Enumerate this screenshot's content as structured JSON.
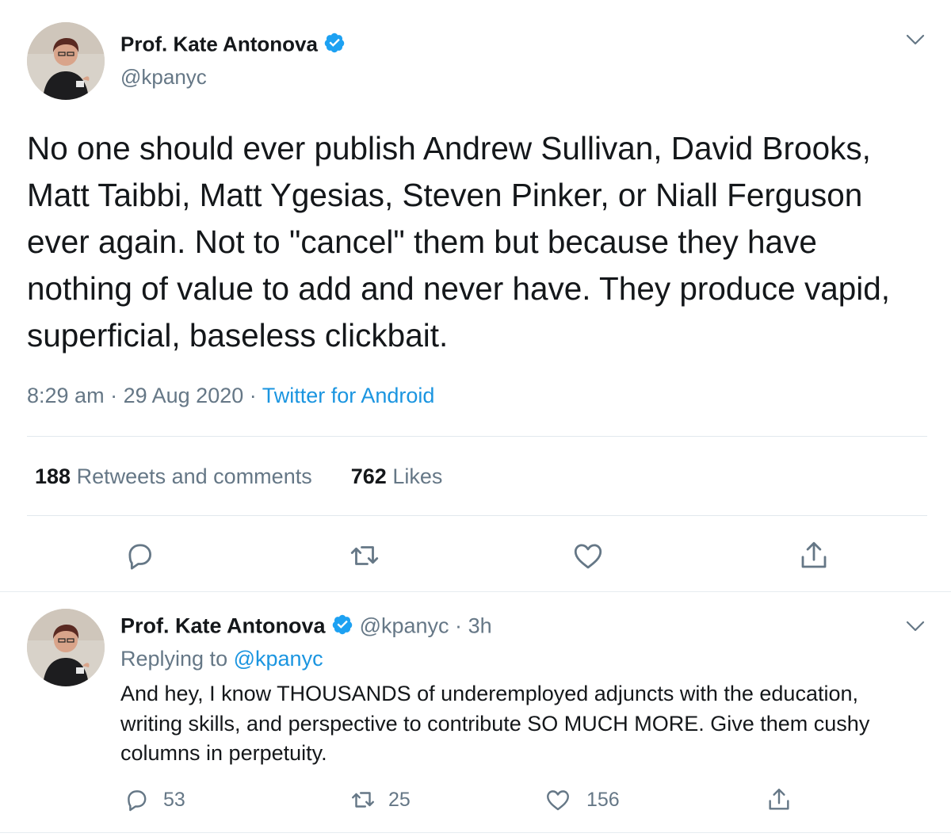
{
  "main_tweet": {
    "display_name": "Prof. Kate Antonova",
    "handle": "@kpanyc",
    "text": "No one should ever publish Andrew Sullivan, David Brooks, Matt Taibbi, Matt Ygesias, Steven Pinker, or Niall Ferguson ever again. Not to \"cancel\" them but because they have nothing of value to add and never have. They produce vapid, superficial, baseless clickbait.",
    "time": "8:29 am",
    "sep1": "·",
    "date": "29 Aug 2020",
    "sep2": "·",
    "source": "Twitter for Android",
    "retweets_count": "188",
    "retweets_label": "Retweets and comments",
    "likes_count": "762",
    "likes_label": "Likes"
  },
  "reply_tweet": {
    "display_name": "Prof. Kate Antonova",
    "handle": "@kpanyc",
    "sep": "·",
    "age": "3h",
    "replying_prefix": "Replying to",
    "replying_handle": "@kpanyc",
    "text": "And hey, I know THOUSANDS of underemployed adjuncts with the education, writing skills, and perspective to contribute SO MUCH MORE. Give them cushy columns in perpetuity.",
    "reply_count": "53",
    "retweet_count": "25",
    "like_count": "156"
  },
  "icons": {
    "verified": "verified-badge-icon",
    "chevron": "chevron-down-icon",
    "reply": "reply-icon",
    "retweet": "retweet-icon",
    "like": "heart-icon",
    "share": "share-icon"
  },
  "colors": {
    "text": "#14171a",
    "muted": "#657786",
    "link": "#1b95e0",
    "divider": "#e1e8ed"
  }
}
